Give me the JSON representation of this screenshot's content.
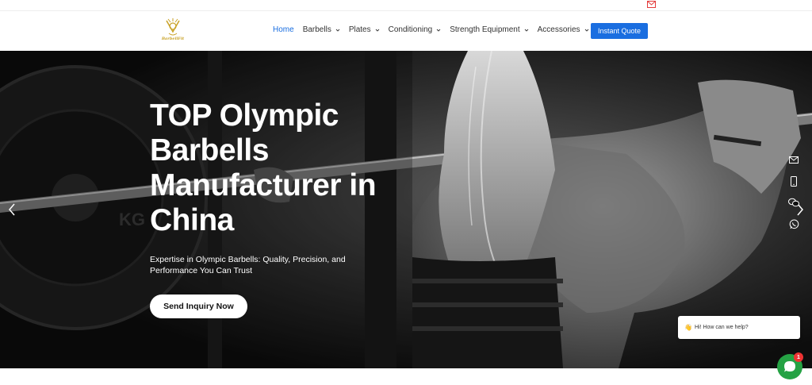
{
  "topbar": {
    "mail_icon": "mail-icon",
    "accent": "#e33a3a"
  },
  "header": {
    "logo_text": "BarbellFit",
    "nav": [
      {
        "label": "Home",
        "active": true,
        "dropdown": false
      },
      {
        "label": "Barbells",
        "active": false,
        "dropdown": true
      },
      {
        "label": "Plates",
        "active": false,
        "dropdown": true
      },
      {
        "label": "Conditioning",
        "active": false,
        "dropdown": true
      },
      {
        "label": "Strength Equipment",
        "active": false,
        "dropdown": true
      },
      {
        "label": "Accessories",
        "active": false,
        "dropdown": true
      }
    ],
    "quote_label": "Instant Quote",
    "accent": "#1a6ee0"
  },
  "hero": {
    "headline_lines": [
      "TOP Olympic",
      "Barbells",
      "Manufacturer in",
      "China"
    ],
    "subtext": "Expertise in Olympic Barbells: Quality, Precision, and Performance You Can Trust",
    "cta_label": "Send Inquiry Now",
    "plate_text": "KG"
  },
  "side_icons": [
    "email-icon",
    "phone-icon",
    "wechat-icon",
    "whatsapp-icon"
  ],
  "chat": {
    "greeting_emoji": "👋",
    "greeting": "Hi! How can we help?",
    "badge_count": "1",
    "color": "#25a244"
  }
}
